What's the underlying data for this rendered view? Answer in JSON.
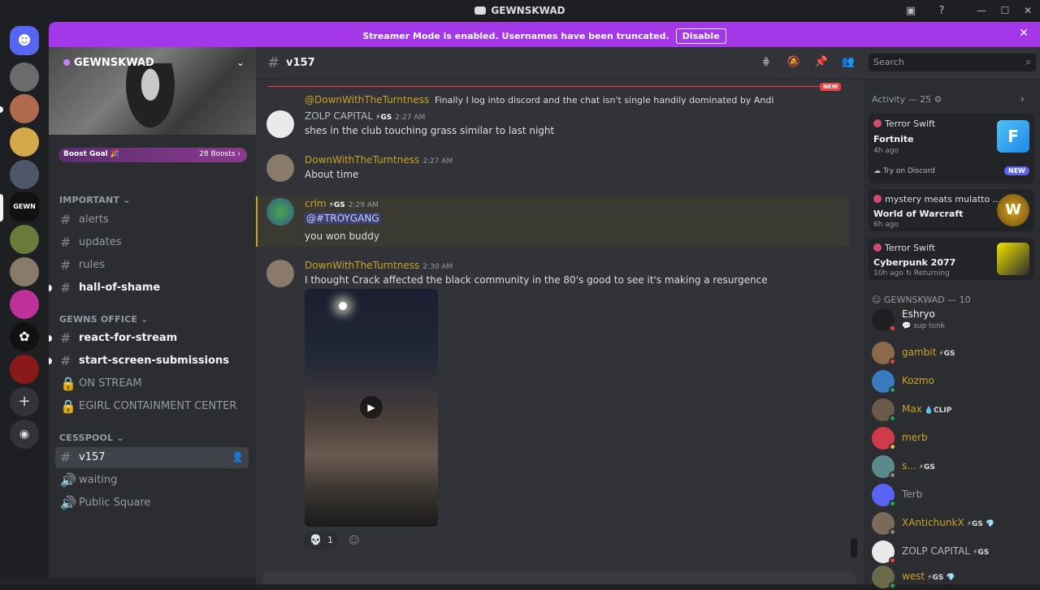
{
  "window": {
    "title": "GEWNSKWAD"
  },
  "banner": {
    "text": "Streamer Mode is enabled. Usernames have been truncated.",
    "button": "Disable"
  },
  "server": {
    "name": "GEWNSKWAD",
    "boost_label": "Boost Goal 🎉",
    "boost_count": "28 Boosts ›"
  },
  "categories": {
    "important": "IMPORTANT ⌄",
    "office": "GEWNS OFFICE ⌄",
    "cesspool": "CESSPOOL ⌄"
  },
  "channels": {
    "alerts": "alerts",
    "updates": "updates",
    "rules": "rules",
    "hall": "hall-of-shame",
    "react": "react-for-stream",
    "start": "start-screen-submissions",
    "onstream": "ON STREAM",
    "egirl": "EGIRL CONTAINMENT CENTER",
    "v157": "v157",
    "waiting": "waiting",
    "public": "Public Square"
  },
  "chat": {
    "channel": "v157",
    "new_tag": "NEW",
    "reply_user": "@DownWithTheTurntness",
    "reply_text": "Finally I log into discord and the chat isn't single handily dominated by Andi",
    "m1_user": "ZOLP CAPITAL",
    "m1_tag": "⚡GS",
    "m1_time": "2:27 AM",
    "m1_text": "shes in the club touching grass similar to last night",
    "m2_user": "DownWithTheTurntness",
    "m2_time": "2:27 AM",
    "m2_text": "About time",
    "m3_user": "crlm",
    "m3_tag": "⚡GS",
    "m3_time": "2:29 AM",
    "m3_mention": "@#TROYGANG",
    "m3_text": "you won buddy",
    "m4_user": "DownWithTheTurntness",
    "m4_time": "2:30 AM",
    "m4_text": "I thought Crack affected the black community in the 80's good to see it's making a resurgence",
    "reaction_emoji": "💀",
    "reaction_count": "1"
  },
  "search": {
    "placeholder": "Search"
  },
  "activity": {
    "title": "Activity — 25 ⚙",
    "c1_user": "Terror Swift",
    "c1_game": "Fortnite",
    "c1_ago": "4h ago",
    "c1_try": "☁ Try on Discord",
    "c1_new": "NEW",
    "c2_user": "mystery meats mulatto ...",
    "c2_game": "World of Warcraft",
    "c2_ago": "6h ago",
    "c3_user": "Terror Swift",
    "c3_game": "Cyberpunk 2077",
    "c3_ago": "10h ago  ↻ Returning"
  },
  "members": {
    "header": "☺ GEWNSKWAD — 10",
    "list": [
      {
        "name": "Eshryo",
        "sub": "💬 sup tonk",
        "badge": ""
      },
      {
        "name": "gambit",
        "sub": "",
        "badge": "⚡GS"
      },
      {
        "name": "Kozmo",
        "sub": "",
        "badge": ""
      },
      {
        "name": "Max",
        "sub": "",
        "badge": "💧CLIP"
      },
      {
        "name": "merb",
        "sub": "",
        "badge": ""
      },
      {
        "name": "s...",
        "sub": "",
        "badge": "⚡GS"
      },
      {
        "name": "Terb",
        "sub": "",
        "badge": ""
      },
      {
        "name": "XAntichunkX",
        "sub": "",
        "badge": "⚡GS 💎"
      },
      {
        "name": "ZOLP CAPITAL",
        "sub": "",
        "badge": "⚡GS"
      },
      {
        "name": "west",
        "sub": "",
        "badge": "⚡GS 💎"
      }
    ]
  }
}
